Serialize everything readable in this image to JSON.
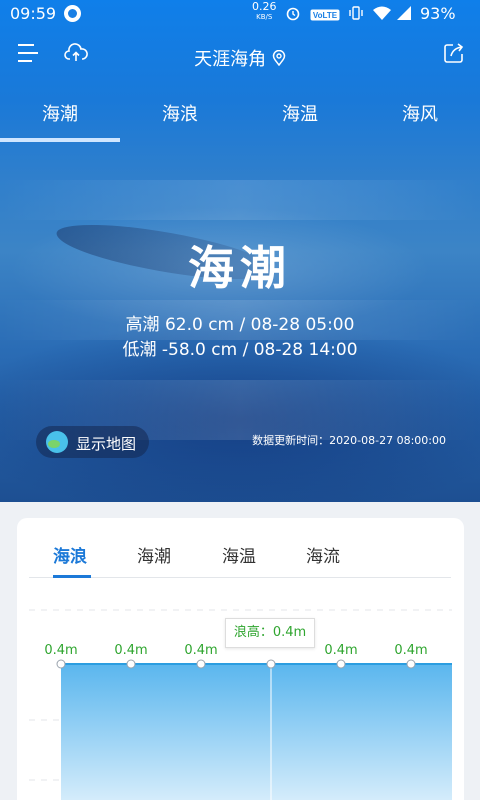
{
  "status": {
    "time": "09:59",
    "speed_value": "0.26",
    "speed_unit": "KB/S",
    "network": "VoLTE",
    "battery": "93%"
  },
  "appbar": {
    "title": "天涯海角"
  },
  "tabs": [
    {
      "label": "海潮",
      "active": true
    },
    {
      "label": "海浪",
      "active": false
    },
    {
      "label": "海温",
      "active": false
    },
    {
      "label": "海风",
      "active": false
    }
  ],
  "hero": {
    "title": "海潮",
    "high_tide": "高潮 62.0 cm / 08-28 05:00",
    "low_tide": "低潮 -58.0 cm / 08-28 14:00",
    "map_button": "显示地图",
    "update_time": "数据更新时间：2020-08-27 08:00:00"
  },
  "card": {
    "tabs": [
      {
        "label": "海浪",
        "active": true
      },
      {
        "label": "海潮",
        "active": false
      },
      {
        "label": "海温",
        "active": false
      },
      {
        "label": "海流",
        "active": false
      }
    ],
    "tooltip": "浪高：0.4m"
  },
  "chart_data": {
    "type": "area",
    "series": [
      {
        "values": [
          0.4,
          0.4,
          0.4,
          0.4,
          0.4,
          0.4
        ],
        "labels": [
          "0.4m",
          "0.4m",
          "0.4m",
          "",
          "0.4m",
          "0.4m"
        ]
      }
    ],
    "highlight_index": 3,
    "color_line": "#2b9de0",
    "color_fill_top": "#5ab6ee",
    "color_fill_bottom": "#e6f4fd",
    "label_color": "#2fa52f"
  },
  "colors": {
    "accent": "#1c79d8",
    "header_top": "#0f7fea"
  }
}
